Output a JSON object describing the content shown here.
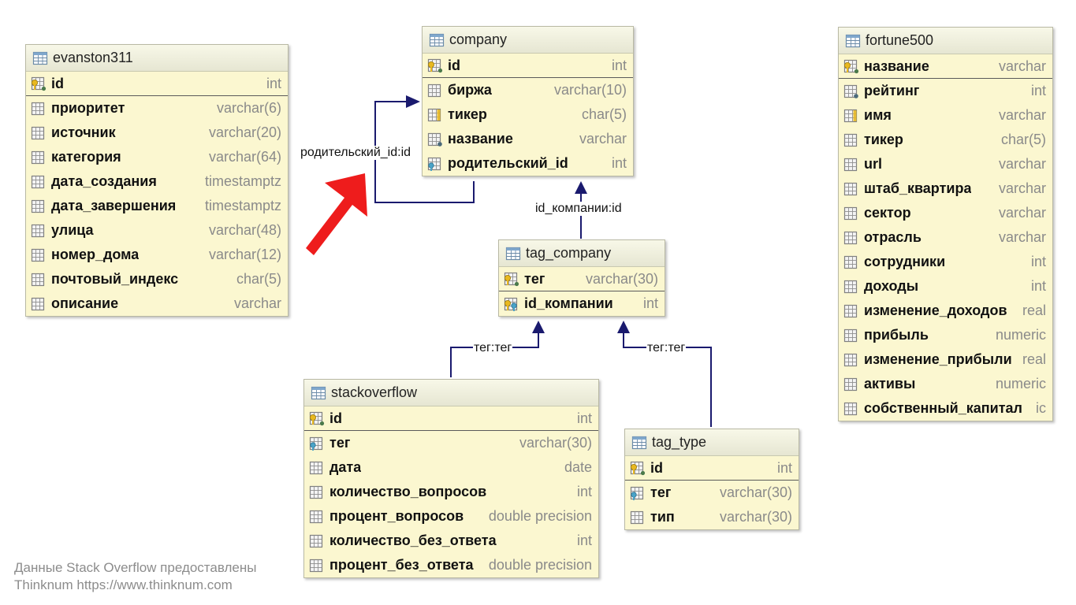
{
  "tables": {
    "evanston311": {
      "title": "evanston311",
      "columns": [
        {
          "name": "id",
          "type": "int",
          "kind": "pk"
        },
        {
          "name": "приоритет",
          "type": "varchar(6)",
          "kind": "col"
        },
        {
          "name": "источник",
          "type": "varchar(20)",
          "kind": "col"
        },
        {
          "name": "категория",
          "type": "varchar(64)",
          "kind": "col"
        },
        {
          "name": "дата_создания",
          "type": "timestamptz",
          "kind": "col"
        },
        {
          "name": "дата_завершения",
          "type": "timestamptz",
          "kind": "col"
        },
        {
          "name": "улица",
          "type": "varchar(48)",
          "kind": "col"
        },
        {
          "name": "номер_дома",
          "type": "varchar(12)",
          "kind": "col"
        },
        {
          "name": "почтовый_индекс",
          "type": "char(5)",
          "kind": "col"
        },
        {
          "name": "описание",
          "type": "varchar",
          "kind": "col"
        }
      ]
    },
    "company": {
      "title": "company",
      "columns": [
        {
          "name": "id",
          "type": "int",
          "kind": "pk"
        },
        {
          "name": "биржа",
          "type": "varchar(10)",
          "kind": "col"
        },
        {
          "name": "тикер",
          "type": "char(5)",
          "kind": "unique"
        },
        {
          "name": "название",
          "type": "varchar",
          "kind": "notnull"
        },
        {
          "name": "родительский_id",
          "type": "int",
          "kind": "fk"
        }
      ]
    },
    "tag_company": {
      "title": "tag_company",
      "columns": [
        {
          "name": "тег",
          "type": "varchar(30)",
          "kind": "pk"
        },
        {
          "name": "id_компании",
          "type": "int",
          "kind": "pkfk"
        }
      ]
    },
    "stackoverflow": {
      "title": "stackoverflow",
      "columns": [
        {
          "name": "id",
          "type": "int",
          "kind": "pk"
        },
        {
          "name": "тег",
          "type": "varchar(30)",
          "kind": "fk"
        },
        {
          "name": "дата",
          "type": "date",
          "kind": "col"
        },
        {
          "name": "количество_вопросов",
          "type": "int",
          "kind": "col"
        },
        {
          "name": "процент_вопросов",
          "type": "double precision",
          "kind": "col"
        },
        {
          "name": "количество_без_ответа",
          "type": "int",
          "kind": "col"
        },
        {
          "name": "процент_без_ответа",
          "type": "double precision",
          "kind": "col"
        }
      ]
    },
    "tag_type": {
      "title": "tag_type",
      "columns": [
        {
          "name": "id",
          "type": "int",
          "kind": "pk"
        },
        {
          "name": "тег",
          "type": "varchar(30)",
          "kind": "fk"
        },
        {
          "name": "тип",
          "type": "varchar(30)",
          "kind": "col"
        }
      ]
    },
    "fortune500": {
      "title": "fortune500",
      "columns": [
        {
          "name": "название",
          "type": "varchar",
          "kind": "pk"
        },
        {
          "name": "рейтинг",
          "type": "int",
          "kind": "notnull"
        },
        {
          "name": "имя",
          "type": "varchar",
          "kind": "unique"
        },
        {
          "name": "тикер",
          "type": "char(5)",
          "kind": "col"
        },
        {
          "name": "url",
          "type": "varchar",
          "kind": "col"
        },
        {
          "name": "штаб_квартира",
          "type": "varchar",
          "kind": "col"
        },
        {
          "name": "сектор",
          "type": "varchar",
          "kind": "col"
        },
        {
          "name": "отрасль",
          "type": "varchar",
          "kind": "col"
        },
        {
          "name": "сотрудники",
          "type": "int",
          "kind": "col"
        },
        {
          "name": "доходы",
          "type": "int",
          "kind": "col"
        },
        {
          "name": "изменение_доходов",
          "type": "real",
          "kind": "col"
        },
        {
          "name": "прибыль",
          "type": "numeric",
          "kind": "col"
        },
        {
          "name": "изменение_прибыли",
          "type": "real",
          "kind": "col"
        },
        {
          "name": "активы",
          "type": "numeric",
          "kind": "col"
        },
        {
          "name": "собственный_капитал",
          "type": "ic",
          "kind": "col"
        }
      ]
    }
  },
  "relations": {
    "company_self": "родительский_id:id",
    "tag_company_company": "id_компании:id",
    "stackoverflow_tag": "тег:тег",
    "tag_type_tag": "тег:тег"
  },
  "footer": {
    "line1": "Данные Stack Overflow предоставлены",
    "line2": "Thinknum https://www.thinknum.com"
  },
  "colors": {
    "line": "#1a1a6e",
    "arrow": "#ee1c1c",
    "table_bg": "#fbf7d0"
  }
}
